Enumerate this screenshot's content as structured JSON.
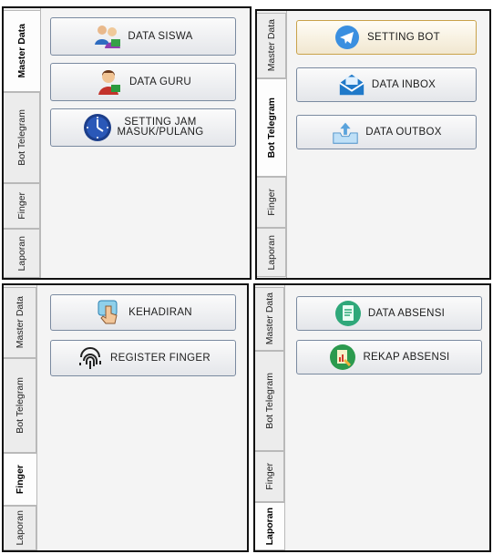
{
  "panels": [
    {
      "tabs": [
        "Master Data",
        "Bot Telegram",
        "Finger",
        "Laporan"
      ],
      "active": 0,
      "buttons": [
        {
          "label": "DATA SISWA",
          "icon": "students-icon"
        },
        {
          "label": "DATA GURU",
          "icon": "teacher-icon"
        },
        {
          "label": "SETTING JAM\nMASUK/PULANG",
          "icon": "clock-icon"
        }
      ]
    },
    {
      "tabs": [
        "Master Data",
        "Bot Telegram",
        "Finger",
        "Laporan"
      ],
      "active": 1,
      "buttons": [
        {
          "label": "SETTING BOT",
          "icon": "telegram-icon"
        },
        {
          "label": "DATA INBOX",
          "icon": "inbox-icon"
        },
        {
          "label": "DATA OUTBOX",
          "icon": "outbox-icon"
        }
      ]
    },
    {
      "tabs": [
        "Master Data",
        "Bot Telegram",
        "Finger",
        "Laporan"
      ],
      "active": 2,
      "buttons": [
        {
          "label": "KEHADIRAN",
          "icon": "touch-icon"
        },
        {
          "label": "REGISTER FINGER",
          "icon": "fingerprint-icon"
        }
      ]
    },
    {
      "tabs": [
        "Master Data",
        "Bot Telegram",
        "Finger",
        "Laporan"
      ],
      "active": 3,
      "buttons": [
        {
          "label": "DATA ABSENSI",
          "icon": "document-icon"
        },
        {
          "label": "REKAP ABSENSI",
          "icon": "report-icon"
        }
      ]
    }
  ]
}
